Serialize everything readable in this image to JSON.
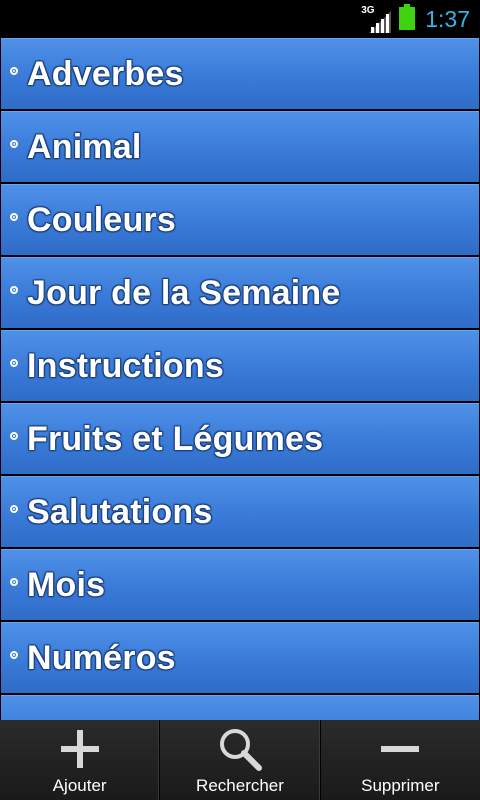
{
  "status_bar": {
    "network_label": "3G",
    "time": "1:37",
    "signal_icon": "signal-icon",
    "battery_icon": "battery-icon",
    "battery_color": "#3fd20e",
    "time_color": "#33b5e5"
  },
  "list": {
    "items": [
      {
        "label": "Adverbes"
      },
      {
        "label": "Animal"
      },
      {
        "label": "Couleurs"
      },
      {
        "label": "Jour de la Semaine"
      },
      {
        "label": "Instructions"
      },
      {
        "label": "Fruits et Légumes"
      },
      {
        "label": "Salutations"
      },
      {
        "label": "Mois"
      },
      {
        "label": "Numéros"
      },
      {
        "label": ""
      }
    ],
    "row_color": "#3a7ad8"
  },
  "toolbar": {
    "add_label": "Ajouter",
    "search_label": "Rechercher",
    "delete_label": "Supprimer",
    "add_icon": "plus-icon",
    "search_icon": "search-icon",
    "delete_icon": "minus-icon"
  }
}
